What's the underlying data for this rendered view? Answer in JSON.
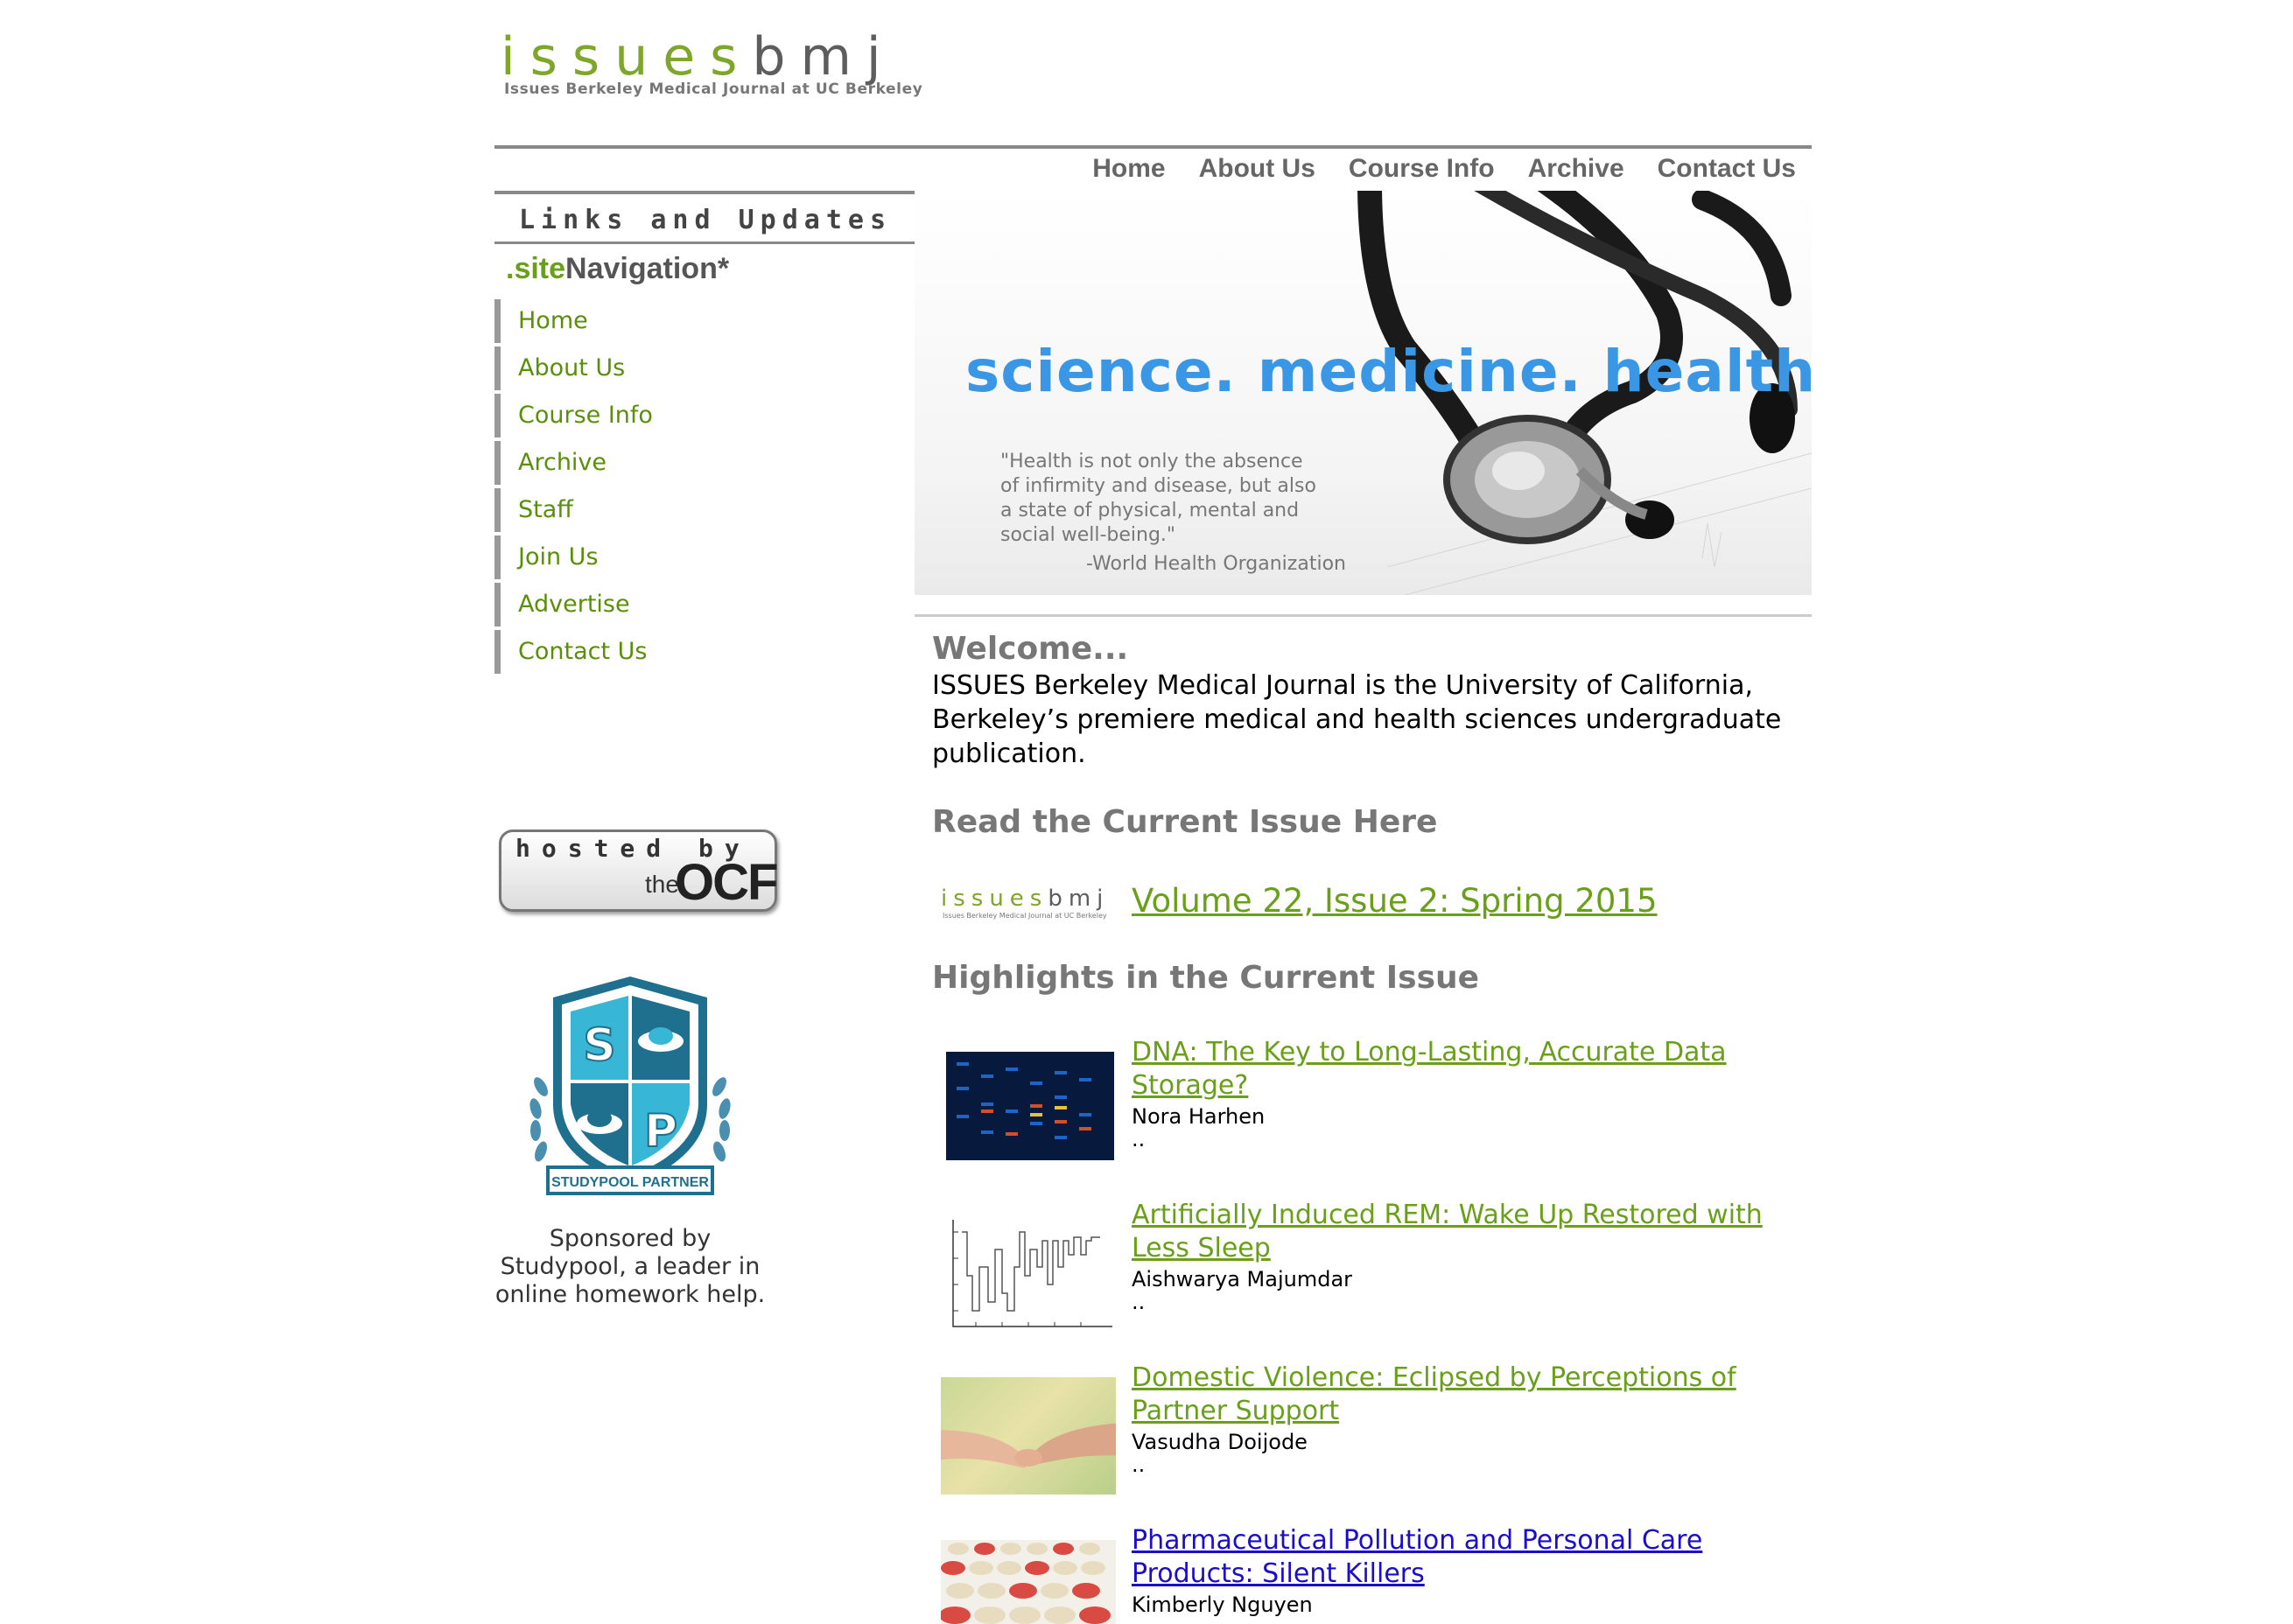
{
  "header": {
    "logo": {
      "word1": "issues",
      "word2": "bmj",
      "subtitle": "Issues Berkeley Medical Journal at UC Berkeley"
    },
    "nav": [
      "Home",
      "About Us",
      "Course Info",
      "Archive",
      "Contact Us"
    ]
  },
  "sidebar": {
    "title": "Links and Updates",
    "site_nav_prefix": ".site",
    "site_nav_label": "Navigation*",
    "items": [
      "Home",
      "About Us",
      "Course Info",
      "Archive",
      "Staff",
      "Join Us",
      "Advertise",
      "Contact Us"
    ],
    "ocf_badge": {
      "hosted_by": "hosted by",
      "the": "the",
      "ocf": "OCF"
    },
    "studypool": {
      "shield_label": "STUDYPOOL PARTNER",
      "letter_s": "S",
      "letter_p": "P",
      "sponsor_text": "Sponsored by Studypool, a leader in online homework help."
    }
  },
  "banner": {
    "tagline": "science. medicine. health.",
    "quote_lines": [
      "\"Health is not only the absence",
      "of infirmity and disease, but also",
      "a state of physical, mental and",
      "social well-being.\""
    ],
    "quote_attribution": "-World Health Organization"
  },
  "main": {
    "welcome_heading": "Welcome...",
    "welcome_text": "ISSUES Berkeley Medical Journal is the University of California, Berkeley’s premiere medical and health sciences undergraduate publication.",
    "current_issue_heading": "Read the Current Issue Here",
    "current_issue_logo": {
      "word1": "issues",
      "word2": "bmj",
      "subtitle": "Issues Berkeley Medical Journal at UC Berkeley"
    },
    "current_issue_link": "Volume 22, Issue 2: Spring 2015",
    "highlights_heading": "Highlights in the Current Issue",
    "articles": [
      {
        "title": "DNA: The Key to Long-Lasting, Accurate Data Storage?",
        "author": "Nora Harhen",
        "excerpt": "..",
        "link_color": "#6a9f19"
      },
      {
        "title": "Artificially Induced REM: Wake Up Restored with Less Sleep",
        "author": "Aishwarya Majumdar",
        "excerpt": "..",
        "link_color": "#6a9f19"
      },
      {
        "title": "Domestic Violence: Eclipsed by Perceptions of Partner Support",
        "author": "Vasudha Doijode",
        "excerpt": "..",
        "link_color": "#6a9f19"
      },
      {
        "title": "Pharmaceutical Pollution and Personal Care Products: Silent Killers",
        "author": "Kimberly Nguyen",
        "excerpt": "",
        "link_color": "#1a0dcc"
      }
    ]
  },
  "colors": {
    "accent_green": "#6a9f19",
    "tagline_blue": "#3a97e6",
    "heading_gray": "#777777"
  }
}
